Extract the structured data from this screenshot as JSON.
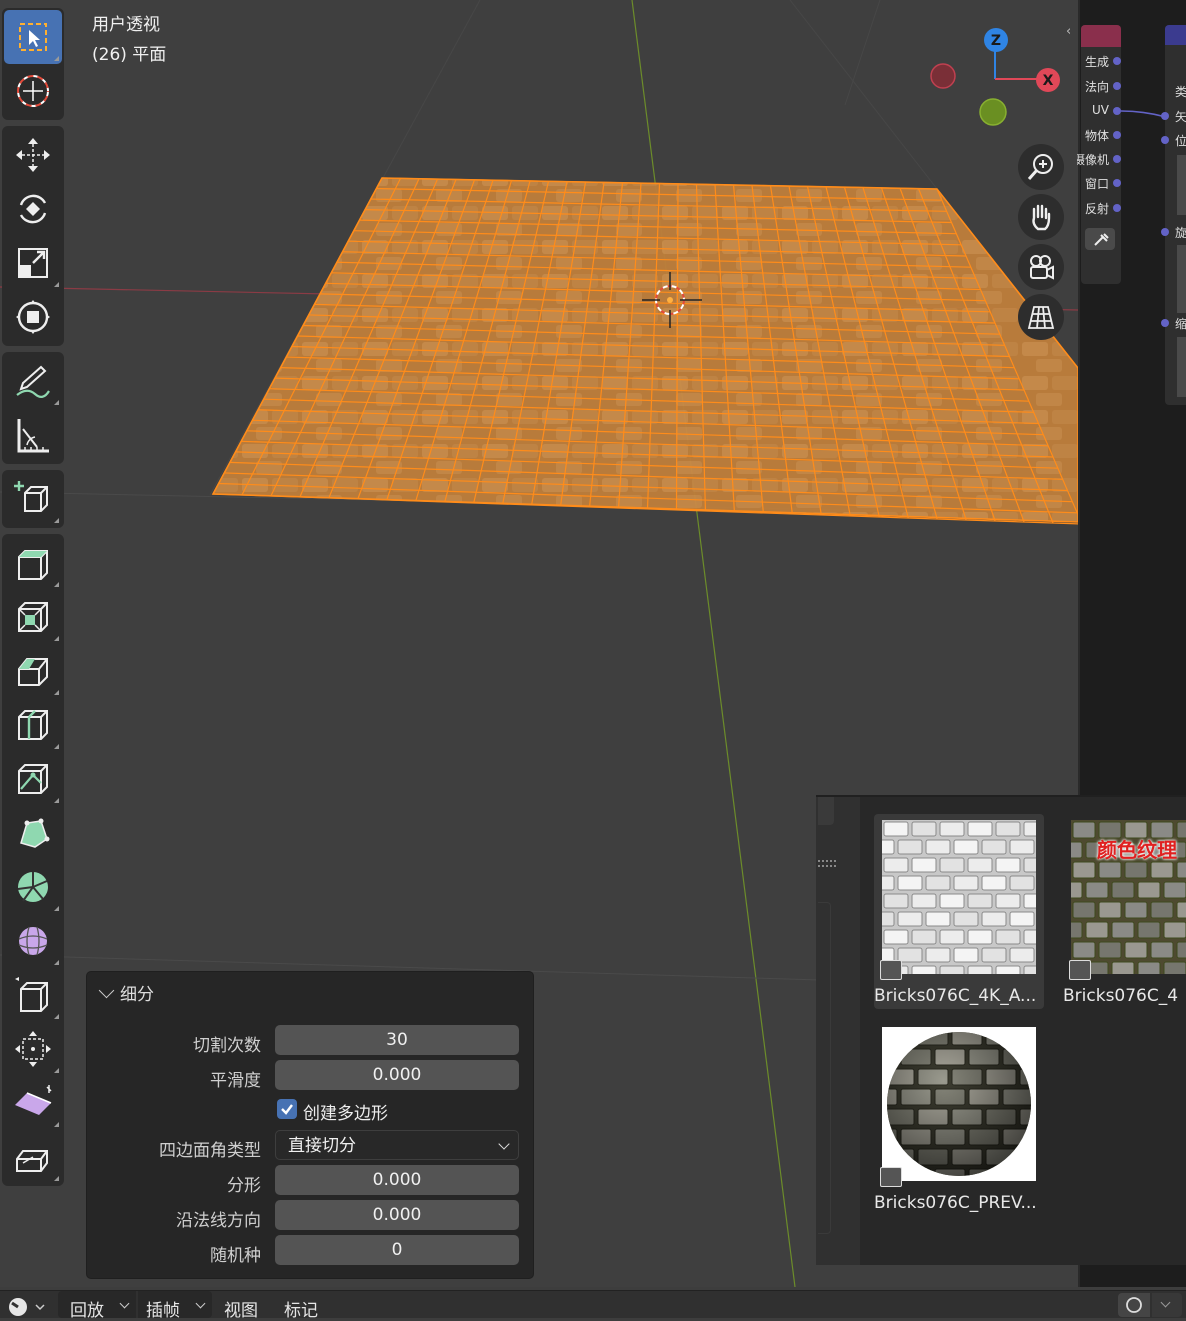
{
  "viewport": {
    "view_name": "用户透视",
    "object_info": "(26) 平面",
    "gizmo": {
      "z_label": "Z",
      "x_label": "X",
      "x_color": "#e04858",
      "z_color": "#2f84e4",
      "y_color": "#7bb02a"
    }
  },
  "toolbar": {
    "tools": [
      "select-box-icon",
      "cursor-icon",
      "move-icon",
      "rotate-icon",
      "scale-icon",
      "transform-icon",
      "annotate-icon",
      "measure-icon",
      "add-cube-icon",
      "extrude-icon",
      "inset-icon",
      "bevel-icon",
      "loop-cut-icon",
      "knife-icon",
      "poly-build-icon",
      "spin-icon",
      "smooth-icon",
      "edge-slide-icon",
      "shrink-fatten-icon",
      "shear-icon",
      "rip-icon"
    ],
    "accent": "#4772b3"
  },
  "node_editor": {
    "node1_sockets": [
      "生成",
      "法向",
      "UV",
      "物体",
      "摄像机",
      "窗口",
      "反射"
    ],
    "node2_labels": [
      "类",
      "矢",
      "位",
      "旋",
      "缩"
    ]
  },
  "asset_browser": {
    "items": [
      {
        "name": "Bricks076C_4K_A...",
        "selected": true
      },
      {
        "name": "Bricks076C_4",
        "overlay": "颜色纹理",
        "selected": false
      },
      {
        "name": "Bricks076C_PREV...",
        "selected": false
      }
    ]
  },
  "operator_panel": {
    "title": "细分",
    "cuts": {
      "label": "切割次数",
      "value": "30"
    },
    "smoothness": {
      "label": "平滑度",
      "value": "0.000"
    },
    "create_ngons": {
      "label": "创建多边形",
      "checked": true
    },
    "quad_corner": {
      "label": "四边面角类型",
      "value": "直接切分"
    },
    "fractal": {
      "label": "分形",
      "value": "0.000"
    },
    "along_normal": {
      "label": "沿法线方向",
      "value": "0.000"
    },
    "random_seed": {
      "label": "随机种",
      "value": "0"
    }
  },
  "timeline": {
    "playback": "回放",
    "keying": "插帧",
    "view": "视图",
    "marker": "标记"
  }
}
